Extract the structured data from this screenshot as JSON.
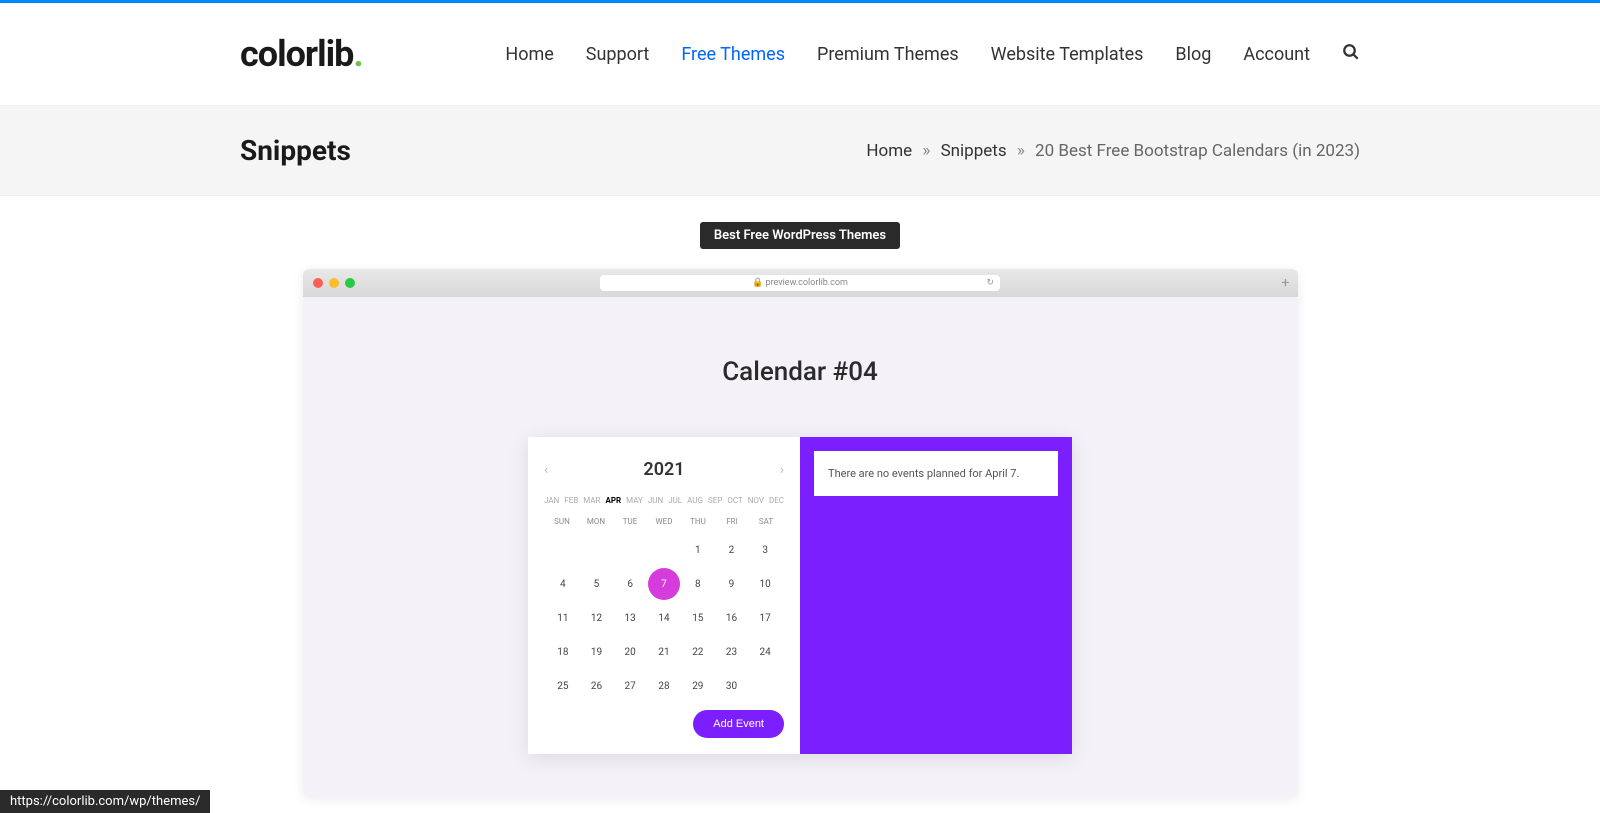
{
  "logo": {
    "text": "colorlib",
    "dot": "."
  },
  "nav": {
    "home": "Home",
    "support": "Support",
    "free_themes": "Free Themes",
    "premium_themes": "Premium Themes",
    "website_templates": "Website Templates",
    "blog": "Blog",
    "account": "Account"
  },
  "page_title": "Snippets",
  "breadcrumb": {
    "home": "Home",
    "snippets": "Snippets",
    "current": "20 Best Free Bootstrap Calendars (in 2023)"
  },
  "badge": "Best Free WordPress Themes",
  "browser": {
    "url": "🔒 preview.colorlib.com"
  },
  "calendar": {
    "title": "Calendar #04",
    "year": "2021",
    "months": [
      "JAN",
      "FEB",
      "MAR",
      "APR",
      "MAY",
      "JUN",
      "JUL",
      "AUG",
      "SEP",
      "OCT",
      "NOV",
      "DEC"
    ],
    "active_month_index": 3,
    "weekdays": [
      "SUN",
      "MON",
      "TUE",
      "WED",
      "THU",
      "FRI",
      "SAT"
    ],
    "days": [
      [
        "",
        "",
        "",
        "",
        "1",
        "2",
        "3"
      ],
      [
        "4",
        "5",
        "6",
        "7",
        "8",
        "9",
        "10"
      ],
      [
        "11",
        "12",
        "13",
        "14",
        "15",
        "16",
        "17"
      ],
      [
        "18",
        "19",
        "20",
        "21",
        "22",
        "23",
        "24"
      ],
      [
        "25",
        "26",
        "27",
        "28",
        "29",
        "30",
        ""
      ]
    ],
    "selected_day": "7",
    "event_message": "There are no events planned for April 7.",
    "add_event_label": "Add Event"
  },
  "status_url": "https://colorlib.com/wp/themes/"
}
